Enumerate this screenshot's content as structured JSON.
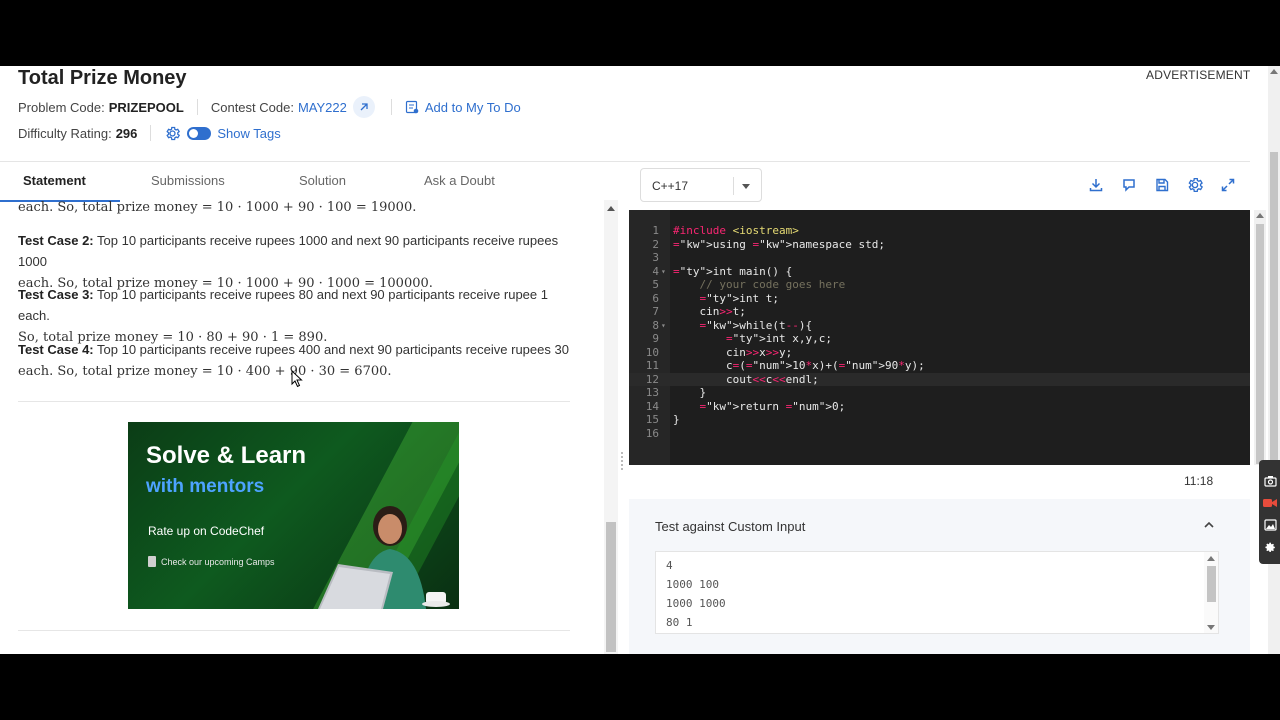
{
  "problem": {
    "title": "Total Prize Money",
    "code_label": "Problem Code:",
    "code_value": "PRIZEPOOL",
    "contest_label": "Contest Code:",
    "contest_value": "MAY222",
    "todo_label": "Add to My To Do",
    "difficulty_label": "Difficulty Rating:",
    "difficulty_value": "296",
    "tags_label": "Show Tags",
    "advertisement": "ADVERTISEMENT"
  },
  "tabs": [
    "Statement",
    "Submissions",
    "Solution",
    "Ask a Doubt"
  ],
  "statement": {
    "line0": "each. So, total prize money = 10 · 1000 + 90 · 100 = 19000.",
    "cases": [
      {
        "label": "Test Case 2:",
        "l1": "Top 10 participants receive rupees 1000 and next 90 participants receive rupees 1000",
        "l2": "each. So, total prize money = 10 · 1000 + 90 · 1000 = 100000."
      },
      {
        "label": "Test Case 3:",
        "l1": "Top 10 participants receive rupees 80 and next 90 participants receive rupee 1 each.",
        "l2": "So, total prize money = 10 · 80 + 90 · 1 = 890."
      },
      {
        "label": "Test Case 4:",
        "l1": "Top 10 participants receive rupees 400 and next 90 participants receive rupees 30",
        "l2": "each. So, total prize money = 10 · 400 + 90 · 30 = 6700."
      }
    ]
  },
  "ad": {
    "headline1": "Solve & Learn",
    "headline2": "with mentors",
    "rate": "Rate up on CodeChef",
    "camps": "Check our upcoming Camps"
  },
  "editor": {
    "language": "C++17",
    "timer": "11:18",
    "lines": [
      {
        "n": "1",
        "t": "#include <iostream>"
      },
      {
        "n": "2",
        "t": "using namespace std;"
      },
      {
        "n": "3",
        "t": ""
      },
      {
        "n": "4",
        "t": "int main() {"
      },
      {
        "n": "5",
        "t": "    // your code goes here"
      },
      {
        "n": "6",
        "t": "    int t;"
      },
      {
        "n": "7",
        "t": "    cin>>t;"
      },
      {
        "n": "8",
        "t": "    while(t--){"
      },
      {
        "n": "9",
        "t": "        int x,y,c;"
      },
      {
        "n": "10",
        "t": "        cin>>x>>y;"
      },
      {
        "n": "11",
        "t": "        c=(10*x)+(90*y);"
      },
      {
        "n": "12",
        "t": "        cout<<c<<endl;"
      },
      {
        "n": "13",
        "t": "    }"
      },
      {
        "n": "14",
        "t": "    return 0;"
      },
      {
        "n": "15",
        "t": "}"
      },
      {
        "n": "16",
        "t": ""
      }
    ]
  },
  "custom_input": {
    "title": "Test against Custom Input",
    "lines": [
      "4",
      "1000 100",
      "1000 1000",
      "80 1"
    ]
  }
}
